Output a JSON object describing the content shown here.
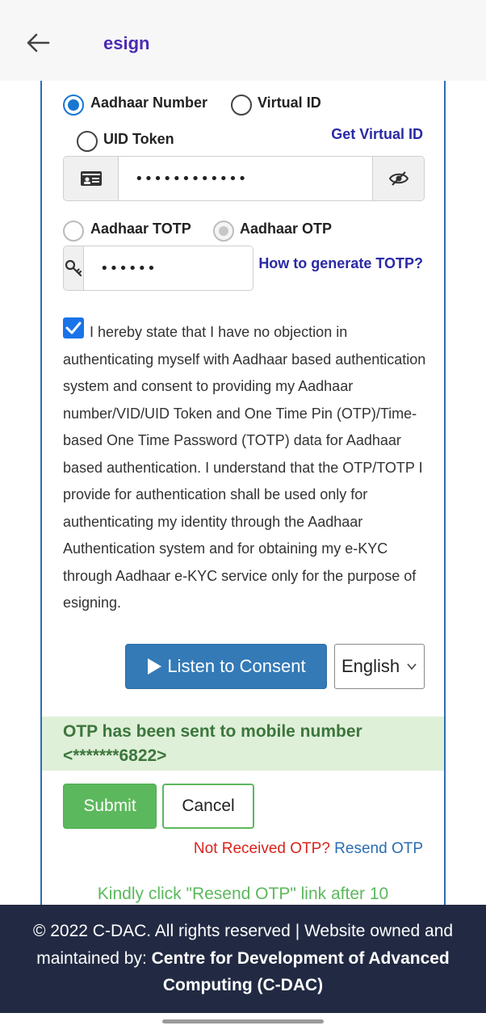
{
  "app": {
    "title": "esign",
    "back_icon": "arrow-left-icon"
  },
  "id_type": {
    "options": [
      {
        "label": "Aadhaar Number",
        "checked": true
      },
      {
        "label": "Virtual ID",
        "checked": false
      },
      {
        "label": "UID Token",
        "checked": false
      }
    ],
    "get_virtual_id_link": "Get Virtual ID"
  },
  "aadhaar_input": {
    "value": "••••••••••••",
    "left_icon": "id-card-icon",
    "right_icon": "eye-slash-icon"
  },
  "auth_type": {
    "options": [
      {
        "label": "Aadhaar TOTP",
        "checked": false
      },
      {
        "label": "Aadhaar OTP",
        "checked": true,
        "disabled": true
      }
    ],
    "how_to_totp_link": "How to generate TOTP?"
  },
  "otp_input": {
    "value": "••••••",
    "left_icon": "key-icon"
  },
  "consent": {
    "checked": true,
    "text": "I hereby state that I have no objection in authenticating myself with Aadhaar based authentication system and consent to providing my Aadhaar number/VID/UID Token and One Time Pin (OTP)/Time-based One Time Password (TOTP) data for Aadhaar based authentication. I understand that the OTP/TOTP I provide for authentication shall be used only for authenticating my identity through the Aadhaar Authentication system and for obtaining my e-KYC through Aadhaar e-KYC service only for the purpose of esigning."
  },
  "listen": {
    "label": "Listen to Consent",
    "icon": "play-icon"
  },
  "language": {
    "selected": "English"
  },
  "otp_status": {
    "line1": "OTP has been sent to mobile number",
    "line2": "<*******6822>"
  },
  "actions": {
    "submit": "Submit",
    "cancel": "Cancel"
  },
  "resend": {
    "prompt": "Not Received OTP?",
    "link": "Resend OTP"
  },
  "notice": "Kindly click \"Resend OTP\" link after 10",
  "footer": {
    "prefix": "© 2022 C-DAC. All rights reserved | Website owned and maintained by: ",
    "org": "Centre for Development of Advanced Computing (C-DAC)"
  },
  "colors": {
    "brand": "#4b2bb3",
    "primary": "#337ab7",
    "success": "#5cb85c",
    "danger": "#d9231d",
    "footer_bg": "#222a43"
  }
}
